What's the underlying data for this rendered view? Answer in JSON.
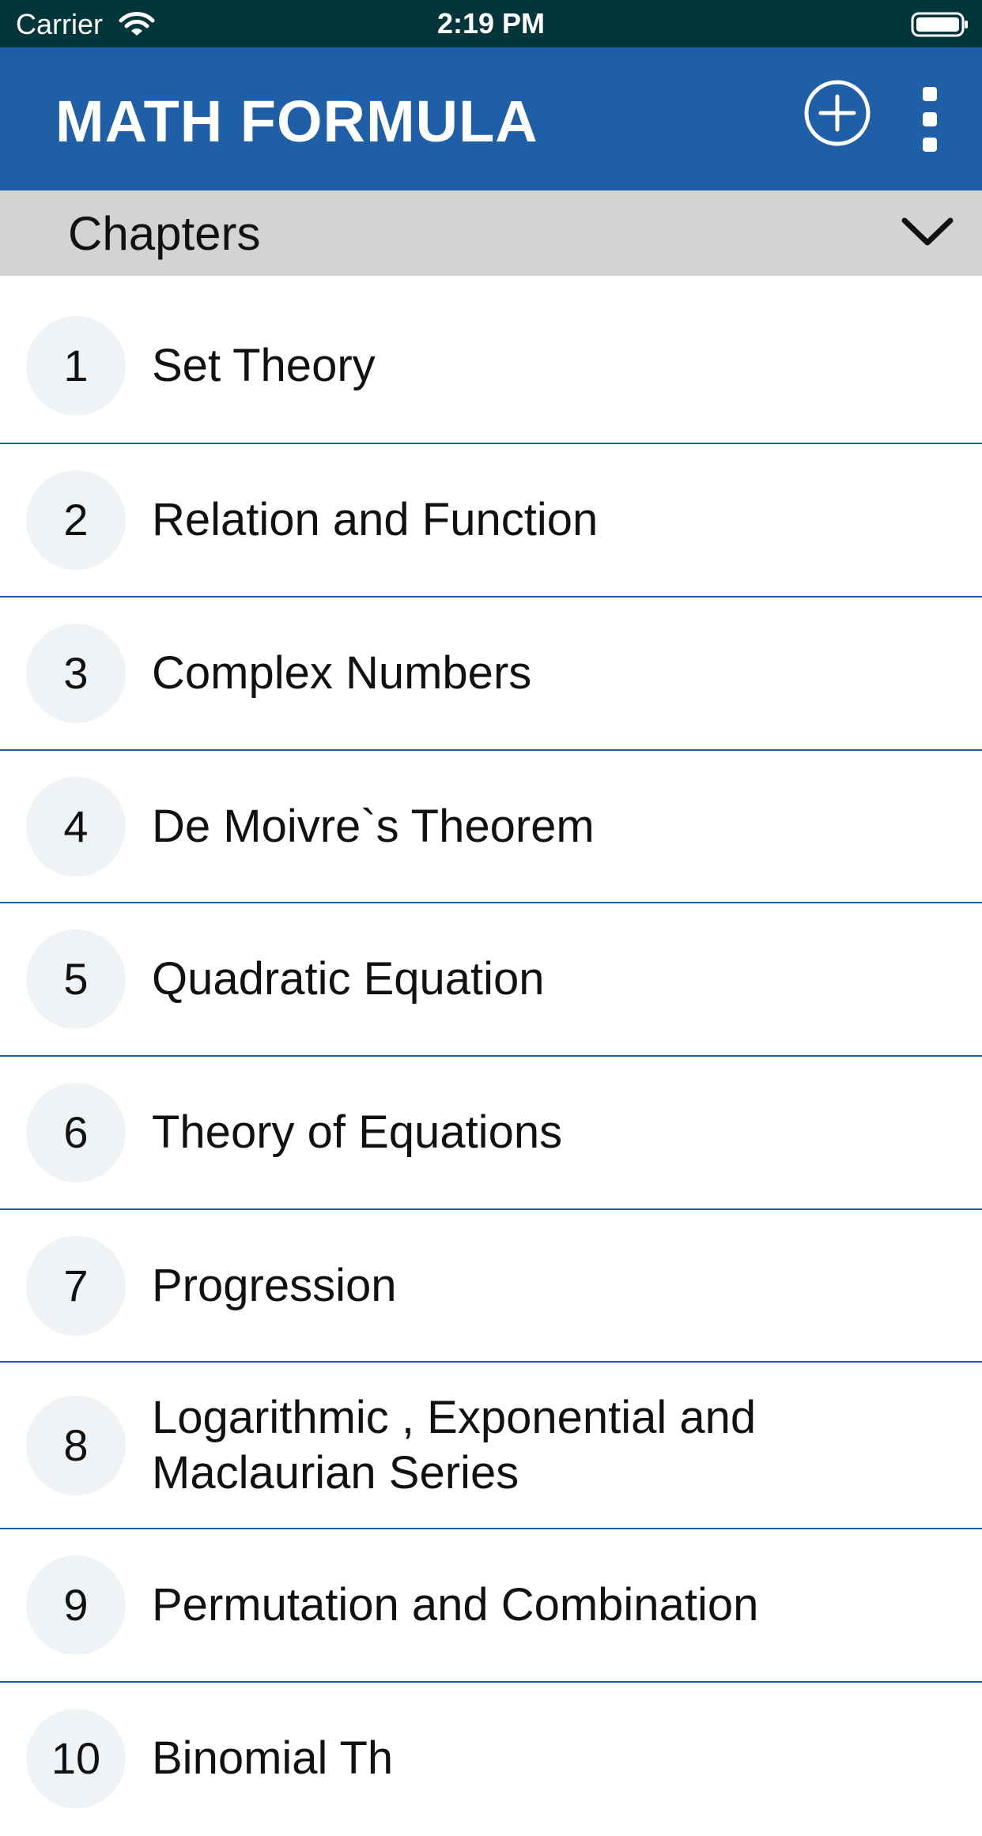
{
  "status_bar": {
    "carrier": "Carrier",
    "time": "2:19 PM"
  },
  "app_bar": {
    "title": "MATH FORMULA",
    "add_icon": "plus-circle-icon",
    "more_icon": "more-vertical-icon"
  },
  "chapters_header": {
    "label": "Chapters",
    "toggle_icon": "chevron-down-icon"
  },
  "chapters": [
    {
      "number": "1",
      "title": "Set Theory"
    },
    {
      "number": "2",
      "title": "Relation and Function"
    },
    {
      "number": "3",
      "title": "Complex Numbers"
    },
    {
      "number": "4",
      "title": "De Moivre`s Theorem"
    },
    {
      "number": "5",
      "title": "Quadratic Equation"
    },
    {
      "number": "6",
      "title": "Theory of Equations"
    },
    {
      "number": "7",
      "title": "Progression"
    },
    {
      "number": "8",
      "title_line1": "Logarithmic , Exponential and",
      "title_line2": "Maclaurian Series"
    },
    {
      "number": "9",
      "title": "Permutation and Combination"
    },
    {
      "number": "10",
      "title": "Binomial Th"
    }
  ],
  "colors": {
    "status_bar": "#02363a",
    "app_bar": "#1f5fa8",
    "header_bg": "#d3d3d3",
    "divider": "#1f5fa8",
    "badge_bg": "#f0f3f5"
  }
}
